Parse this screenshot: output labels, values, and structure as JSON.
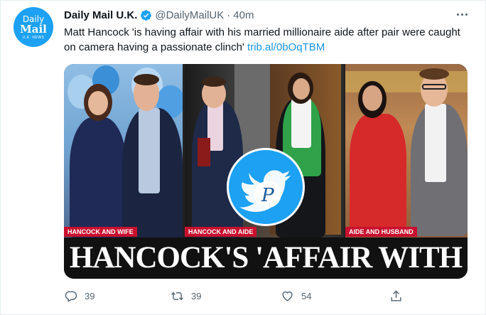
{
  "tweet": {
    "avatar": {
      "line1": "Daily",
      "line2": "Mail",
      "line3": "U.K. NEWS"
    },
    "name": "Daily Mail U.K.",
    "handle": "@DailyMailUK",
    "separator": "·",
    "time": "40m",
    "text": "Matt Hancock 'is having affair with his married millionaire aide after pair were caught on camera having a passionate clinch'",
    "link": "trib.al/0bOqTBM"
  },
  "media": {
    "captions": [
      "HANCOCK AND WIFE",
      "HANCOCK AND AIDE",
      "AIDE AND HUSBAND"
    ],
    "headline": "HANCOCK'S 'AFFAIR WITH AIDE'"
  },
  "actions": {
    "reply_count": "39",
    "retweet_count": "39",
    "like_count": "54"
  },
  "colors": {
    "accent": "#1da1f2",
    "link": "#1b95e0",
    "muted": "#536471",
    "caption_red": "#c8102e"
  }
}
